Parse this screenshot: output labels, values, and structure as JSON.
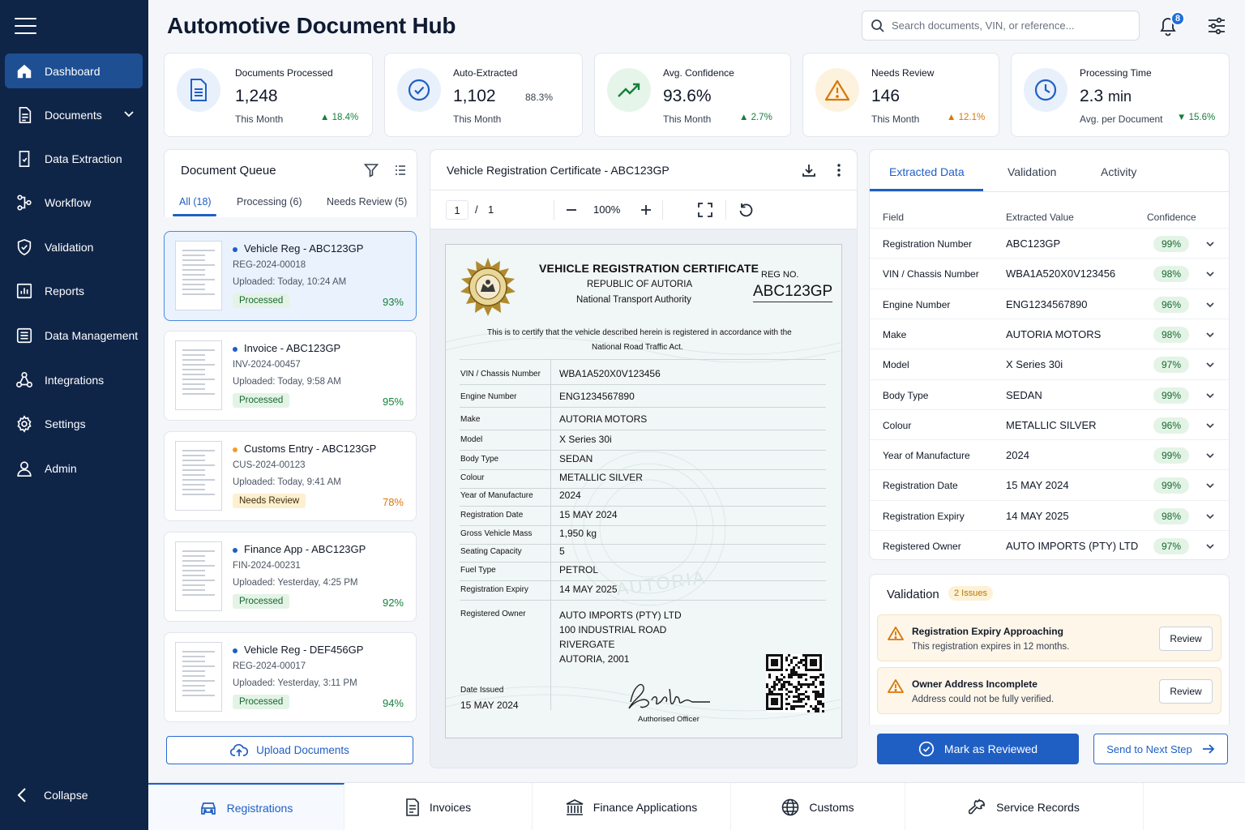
{
  "app": {
    "title": "Automotive Document Hub"
  },
  "search": {
    "placeholder": "Search documents, VIN, or reference..."
  },
  "notifications": {
    "count": "8"
  },
  "sidebar": {
    "items": [
      {
        "label": "Dashboard",
        "icon": "home-icon"
      },
      {
        "label": "Documents",
        "icon": "document-icon"
      },
      {
        "label": "Data Extraction",
        "icon": "extraction-icon"
      },
      {
        "label": "Workflow",
        "icon": "workflow-icon"
      },
      {
        "label": "Validation",
        "icon": "shield-icon"
      },
      {
        "label": "Reports",
        "icon": "reports-icon"
      },
      {
        "label": "Data Management",
        "icon": "database-icon"
      },
      {
        "label": "Integrations",
        "icon": "integrations-icon"
      },
      {
        "label": "Settings",
        "icon": "gear-icon"
      },
      {
        "label": "Admin",
        "icon": "user-icon"
      }
    ],
    "collapse_label": "Collapse"
  },
  "stats": [
    {
      "label": "Documents Processed",
      "value": "1,248",
      "sub": "This Month",
      "delta": "▲ 18.4%",
      "icon": "document-icon"
    },
    {
      "label": "Auto-Extracted",
      "value": "1,102",
      "side": "88.3%",
      "sub": "This Month",
      "icon": "check-circle-icon"
    },
    {
      "label": "Avg. Confidence",
      "value": "93.6%",
      "sub": "This Month",
      "delta": "▲ 2.7%",
      "icon": "trend-up-icon"
    },
    {
      "label": "Needs Review",
      "value": "146",
      "sub": "This Month",
      "delta": "▲ 12.1%",
      "icon": "warning-icon"
    },
    {
      "label": "Processing Time",
      "value": "2.3",
      "unit": "min",
      "sub": "Avg. per Document",
      "delta": "▼ 15.6%",
      "icon": "clock-icon"
    }
  ],
  "queue": {
    "title": "Document Queue",
    "tabs": [
      "All (18)",
      "Processing (6)",
      "Needs Review (5)"
    ],
    "items": [
      {
        "name": "Vehicle Reg - ABC123GP",
        "ref": "REG-2024-00018",
        "uploaded": "Uploaded: Today, 10:24 AM",
        "status": "Processed",
        "confidence": "93%",
        "dot_color": "#1f5fc4"
      },
      {
        "name": "Invoice - ABC123GP",
        "ref": "INV-2024-00457",
        "uploaded": "Uploaded: Today, 9:58 AM",
        "status": "Processed",
        "confidence": "95%",
        "dot_color": "#1f5fc4"
      },
      {
        "name": "Customs Entry - ABC123GP",
        "ref": "CUS-2024-00123",
        "uploaded": "Uploaded: Today, 9:41 AM",
        "status": "Needs Review",
        "confidence": "78%",
        "dot_color": "#f0a020"
      },
      {
        "name": "Finance App - ABC123GP",
        "ref": "FIN-2024-00231",
        "uploaded": "Uploaded: Yesterday, 4:25 PM",
        "status": "Processed",
        "confidence": "92%",
        "dot_color": "#1f5fc4"
      },
      {
        "name": "Vehicle Reg - DEF456GP",
        "ref": "REG-2024-00017",
        "uploaded": "Uploaded: Yesterday, 3:11 PM",
        "status": "Processed",
        "confidence": "94%",
        "dot_color": "#1f5fc4"
      }
    ],
    "upload_label": "Upload Documents"
  },
  "viewer": {
    "title": "Vehicle Registration Certificate - ABC123GP",
    "page": "1",
    "page_sep": "/",
    "page_total": "1",
    "zoom": "100%"
  },
  "certificate": {
    "title": "VEHICLE REGISTRATION CERTIFICATE",
    "country": "REPUBLIC OF AUTORIA",
    "authority": "National Transport Authority",
    "reg_label": "REG NO.",
    "reg_no": "ABC123GP",
    "certify_line1": "This is to certify that the vehicle described herein is registered in accordance with the",
    "certify_line2": "National Road Traffic Act.",
    "watermark": "AUTORIA",
    "fields": [
      {
        "label": "VIN / Chassis Number",
        "value": "WBA1A520X0V123456"
      },
      {
        "label": "Engine Number",
        "value": "ENG1234567890"
      },
      {
        "label": "Make",
        "value": "AUTORIA MOTORS"
      },
      {
        "label": "Model",
        "value": "X Series 30i"
      },
      {
        "label": "Body Type",
        "value": "SEDAN"
      },
      {
        "label": "Colour",
        "value": "METALLIC SILVER"
      },
      {
        "label": "Year of Manufacture",
        "value": "2024"
      },
      {
        "label": "Registration Date",
        "value": "15 MAY 2024"
      },
      {
        "label": "Gross Vehicle Mass",
        "value": "1,950 kg"
      },
      {
        "label": "Seating Capacity",
        "value": "5"
      },
      {
        "label": "Fuel Type",
        "value": "PETROL"
      },
      {
        "label": "Registration Expiry",
        "value": "14 MAY 2025"
      }
    ],
    "owner_label": "Registered Owner",
    "owner_lines": [
      "AUTO IMPORTS (PTY) LTD",
      "100 INDUSTRIAL ROAD",
      "RIVERGATE",
      "AUTORIA, 2001"
    ],
    "date_issued_label": "Date Issued",
    "date_issued": "15 MAY 2024",
    "officer_label": "Authorised Officer"
  },
  "extracted": {
    "tabs": [
      "Extracted Data",
      "Validation",
      "Activity"
    ],
    "columns": [
      "Field",
      "Extracted Value",
      "Confidence"
    ],
    "rows": [
      {
        "field": "Registration Number",
        "value": "ABC123GP",
        "confidence": "99%"
      },
      {
        "field": "VIN / Chassis Number",
        "value": "WBA1A520X0V123456",
        "confidence": "98%"
      },
      {
        "field": "Engine Number",
        "value": "ENG1234567890",
        "confidence": "96%"
      },
      {
        "field": "Make",
        "value": "AUTORIA MOTORS",
        "confidence": "98%"
      },
      {
        "field": "Model",
        "value": "X Series 30i",
        "confidence": "97%"
      },
      {
        "field": "Body Type",
        "value": "SEDAN",
        "confidence": "99%"
      },
      {
        "field": "Colour",
        "value": "METALLIC SILVER",
        "confidence": "96%"
      },
      {
        "field": "Year of Manufacture",
        "value": "2024",
        "confidence": "99%"
      },
      {
        "field": "Registration Date",
        "value": "15 MAY 2024",
        "confidence": "99%"
      },
      {
        "field": "Registration Expiry",
        "value": "14 MAY 2025",
        "confidence": "98%"
      },
      {
        "field": "Registered Owner",
        "value": "AUTO IMPORTS (PTY) LTD",
        "confidence": "97%"
      }
    ]
  },
  "validation": {
    "title": "Validation",
    "badge": "2 Issues",
    "issues": [
      {
        "title": "Registration Expiry Approaching",
        "desc": "This registration expires in 12 months.",
        "action": "Review"
      },
      {
        "title": "Owner Address Incomplete",
        "desc": "Address could not be fully verified.",
        "action": "Review"
      }
    ]
  },
  "actions": {
    "primary": "Mark as Reviewed",
    "secondary": "Send to Next Step"
  },
  "bottom_tabs": [
    {
      "label": "Registrations",
      "icon": "car-icon"
    },
    {
      "label": "Invoices",
      "icon": "invoice-icon"
    },
    {
      "label": "Finance Applications",
      "icon": "bank-icon"
    },
    {
      "label": "Customs",
      "icon": "globe-icon"
    },
    {
      "label": "Service Records",
      "icon": "wrench-icon"
    }
  ],
  "colors": {
    "sidebar": "#0f2548",
    "accent": "#1f5fc4",
    "success": "#16803c",
    "warning": "#d97706"
  }
}
